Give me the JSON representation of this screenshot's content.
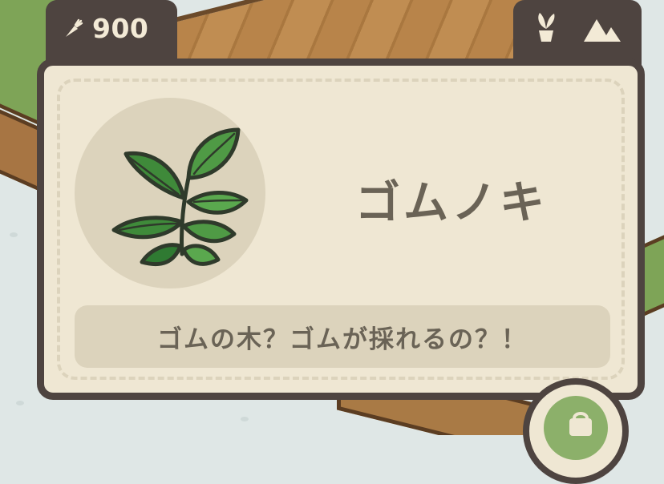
{
  "hud": {
    "carrot_count": "900",
    "carrot_icon": "carrot-icon",
    "right_tab_icons": [
      "potted-plant-icon",
      "mountain-icon"
    ]
  },
  "item_card": {
    "name": "ゴムノキ",
    "description": "ゴムの木？ゴムが採れるの？！",
    "image_icon": "rubber-tree-plant-icon"
  },
  "colors": {
    "frame": "#4e4440",
    "card_bg": "#efe7d3",
    "panel_bg": "#dcd3bc",
    "text": "#6a6356",
    "leaf": "#3f8a3a"
  }
}
